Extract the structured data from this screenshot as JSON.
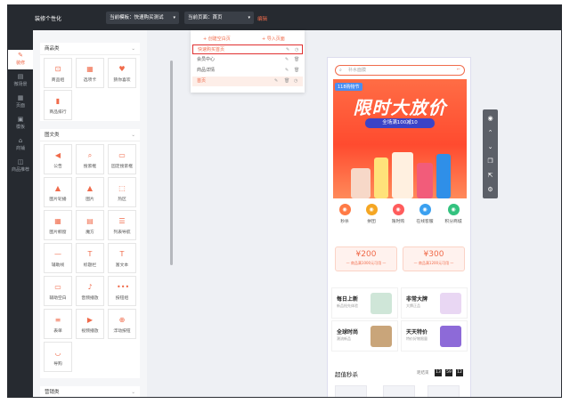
{
  "header": {
    "brand": "装修个性化",
    "template_select": "当前模板：快速购买测试",
    "page_select": "当前页面：首页",
    "edit_link": "编辑"
  },
  "leftnav": {
    "items": [
      {
        "icon": "brush-icon",
        "label": "装修"
      },
      {
        "icon": "page-icon",
        "label": "微场景"
      },
      {
        "icon": "doc-icon",
        "label": "页面"
      },
      {
        "icon": "template-icon",
        "label": "模板"
      },
      {
        "icon": "store-icon",
        "label": "商铺"
      },
      {
        "icon": "product-icon",
        "label": "商品推荐"
      }
    ]
  },
  "panel": {
    "sections": [
      {
        "title": "商品类",
        "items": [
          {
            "label": "商品组",
            "icon": "⊡"
          },
          {
            "label": "选项卡",
            "icon": "▦"
          },
          {
            "label": "猜你喜欢",
            "icon": "♥"
          },
          {
            "label": "商品排行",
            "icon": "▮"
          }
        ]
      },
      {
        "title": "图文类",
        "items": [
          {
            "label": "公告",
            "icon": "◀"
          },
          {
            "label": "搜索框",
            "icon": "⌕"
          },
          {
            "label": "固定搜索框",
            "icon": "▭"
          },
          {
            "label": "图片轮播",
            "icon": "▲"
          },
          {
            "label": "图片",
            "icon": "▲"
          },
          {
            "label": "热区",
            "icon": "⬚"
          },
          {
            "label": "图片橱窗",
            "icon": "▦"
          },
          {
            "label": "魔方",
            "icon": "▤"
          },
          {
            "label": "列表导航",
            "icon": "☰"
          },
          {
            "label": "辅助线",
            "icon": "—"
          },
          {
            "label": "标题栏",
            "icon": "T"
          },
          {
            "label": "富文本",
            "icon": "T"
          },
          {
            "label": "辅助空白",
            "icon": "▭"
          },
          {
            "label": "音频播放",
            "icon": "♪"
          },
          {
            "label": "按钮组",
            "icon": "•••"
          },
          {
            "label": "表单",
            "icon": "≡"
          },
          {
            "label": "视频播放",
            "icon": "▶"
          },
          {
            "label": "浮动按钮",
            "icon": "⊕"
          },
          {
            "label": "导购",
            "icon": "◡"
          }
        ]
      },
      {
        "title": "营销类"
      }
    ]
  },
  "page_dropdown": {
    "create_button": "+ 创建空白页",
    "import_button": "+ 导入页面",
    "pages": [
      {
        "label": "快速购买首页",
        "icons": [
          "✎",
          "◷"
        ]
      },
      {
        "label": "会员中心",
        "icons": [
          "✎",
          "🗑"
        ]
      },
      {
        "label": "商品详情",
        "icons": [
          "✎",
          "🗑"
        ]
      },
      {
        "label": "首页",
        "icons": [
          "✎",
          "🗑",
          "◷"
        ]
      }
    ]
  },
  "preview": {
    "search_placeholder": "补水面膜",
    "banner": {
      "tag": "118购物节",
      "title": "限时大放价",
      "subtitle": "全场满100减10"
    },
    "categories": [
      {
        "label": "秒杀",
        "color": "#ff7a45"
      },
      {
        "label": "拼团",
        "color": "#f5a623"
      },
      {
        "label": "限时购",
        "color": "#ff5c5c"
      },
      {
        "label": "在线客服",
        "color": "#3aa0f0"
      },
      {
        "label": "积分商城",
        "color": "#33c27f"
      }
    ],
    "coupons": [
      {
        "value": "¥200",
        "desc": "— 商品满1000元可用 —"
      },
      {
        "value": "¥300",
        "desc": "— 商品满1200元可用 —"
      }
    ],
    "promos": [
      {
        "title": "每日上新",
        "sub": "新品抢先体验",
        "color": "#cfe6d8"
      },
      {
        "title": "非常大牌",
        "sub": "大牌正品",
        "color": "#e9d7f3"
      },
      {
        "title": "全球时尚",
        "sub": "潮流新品",
        "color": "#c9a57a"
      },
      {
        "title": "天天特价",
        "sub": "特价好物限量",
        "color": "#8d6ad8"
      }
    ],
    "flash": {
      "title": "超值秒杀",
      "countdown_label": "距结束",
      "timer": [
        "13",
        "59",
        "12"
      ]
    }
  },
  "toolbar": {
    "icons": [
      "eye-icon",
      "arrow-up-icon",
      "arrow-down-icon",
      "copy-icon",
      "share-icon",
      "settings-icon"
    ]
  }
}
